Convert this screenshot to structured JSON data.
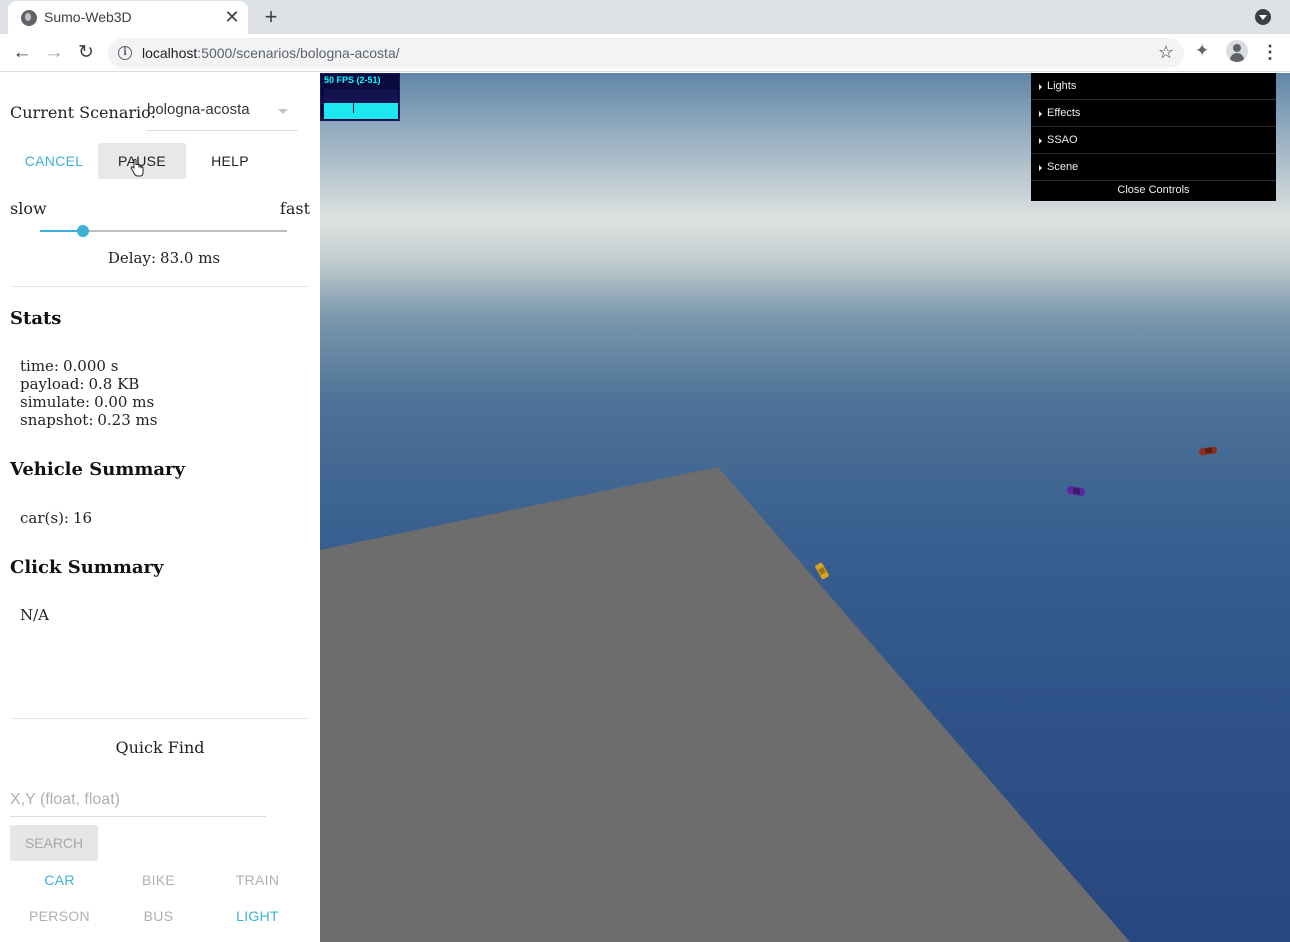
{
  "browser": {
    "tab_title": "Sumo-Web3D",
    "tab_close": "✕",
    "new_tab": "+",
    "url_host": "localhost",
    "url_rest": ":5000/scenarios/bologna-acosta/",
    "icons": [
      "globe-icon",
      "close-icon",
      "plus-icon",
      "back-icon",
      "forward-icon",
      "reload-icon",
      "info-icon",
      "star-icon",
      "puzzle-icon",
      "profile-icon",
      "kebab-icon",
      "tab-menu-icon"
    ]
  },
  "panel": {
    "scenario_label": "Current Scenario:",
    "scenario_value": "bologna-acosta",
    "buttons": {
      "cancel": "CANCEL",
      "pause": "PAUSE",
      "help": "HELP"
    },
    "speed": {
      "slow": "slow",
      "fast": "fast",
      "value_fraction": 0.175
    },
    "delay_label": "Delay:",
    "delay_value": "83.0 ms",
    "stats_heading": "Stats",
    "stats": [
      {
        "label": "time:",
        "value": "0.000 s"
      },
      {
        "label": "payload:",
        "value": "0.8 KB"
      },
      {
        "label": "simulate:",
        "value": "0.00 ms"
      },
      {
        "label": "snapshot:",
        "value": "0.23 ms"
      }
    ],
    "vehicle_heading": "Vehicle Summary",
    "vehicle_label": "car(s):",
    "vehicle_value": "16",
    "click_heading": "Click Summary",
    "click_value": "N/A",
    "quickfind_title": "Quick Find",
    "quickfind_placeholder": "X,Y (float, float)",
    "search_label": "SEARCH",
    "filters": [
      {
        "label": "CAR",
        "active": true
      },
      {
        "label": "BIKE",
        "active": false
      },
      {
        "label": "TRAIN",
        "active": false
      },
      {
        "label": "PERSON",
        "active": false
      },
      {
        "label": "BUS",
        "active": false
      },
      {
        "label": "LIGHT",
        "active": true
      }
    ],
    "accent_color": "#3cb1d9"
  },
  "viewport": {
    "fps_text": "50 FPS (2-51)",
    "controls": [
      "Lights",
      "Effects",
      "SSAO",
      "Scene"
    ],
    "close_controls": "Close Controls",
    "ground_color": "#6d6d6d",
    "vehicle_colors": [
      "#d4a521",
      "#5a2a9a",
      "#8a2e20"
    ]
  }
}
